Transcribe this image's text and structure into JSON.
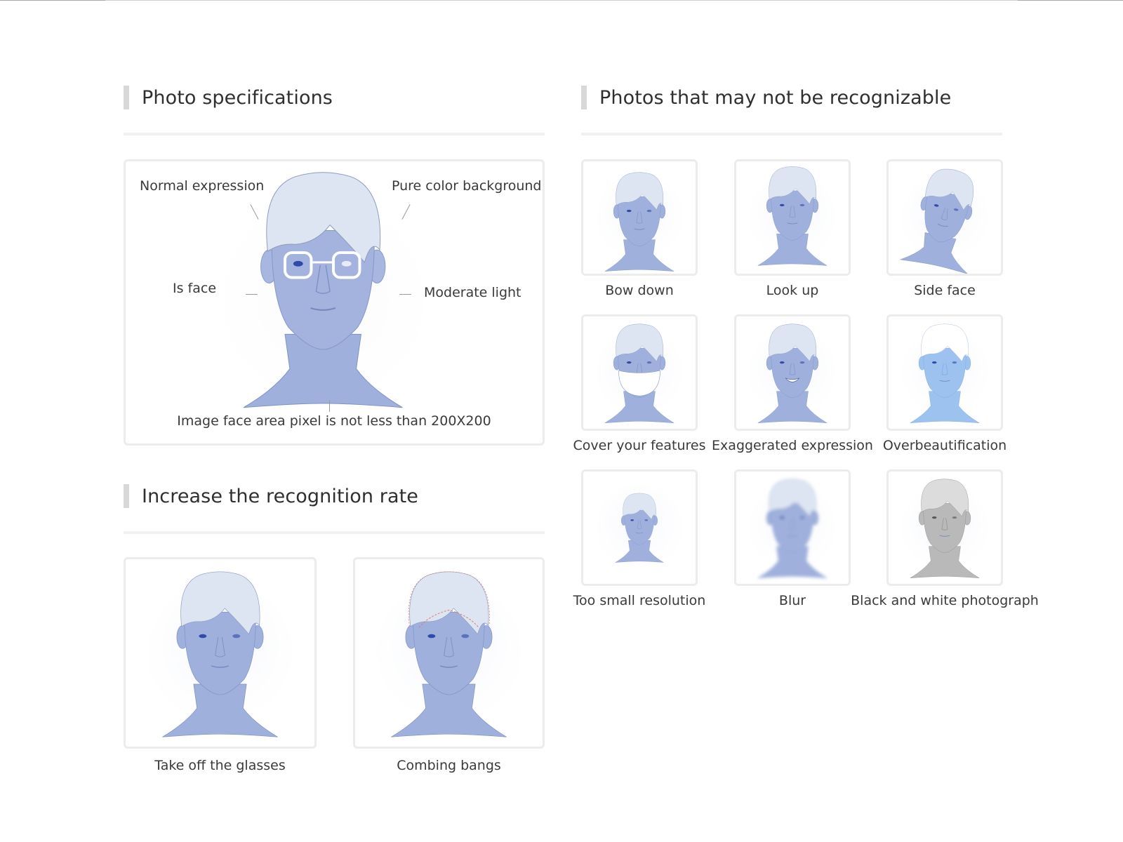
{
  "sections": {
    "specs": {
      "title": "Photo specifications"
    },
    "not_recognizable": {
      "title": "Photos that may not be recognizable"
    },
    "increase": {
      "title": "Increase the recognition rate"
    }
  },
  "spec_card": {
    "labels": {
      "normal_expression": "Normal expression",
      "pure_color_background": "Pure color background",
      "is_face": "Is face",
      "moderate_light": "Moderate light",
      "face_area": "Image face area pixel is not less than 200X200"
    }
  },
  "increase_items": [
    {
      "caption": "Take off the glasses"
    },
    {
      "caption": "Combing bangs"
    }
  ],
  "bad_items": [
    {
      "caption": "Bow down"
    },
    {
      "caption": "Look up"
    },
    {
      "caption": "Side face"
    },
    {
      "caption": "Cover your features"
    },
    {
      "caption": "Exaggerated expression"
    },
    {
      "caption": "Overbeautification"
    },
    {
      "caption": "Too small resolution"
    },
    {
      "caption": "Blur"
    },
    {
      "caption": "Black and white photograph"
    }
  ],
  "colors": {
    "face": "#9fb0dc",
    "face_shadow": "#7f92c6",
    "hair": "#dde5f3",
    "hair_line": "#8e9bbf",
    "card_border": "#ececec",
    "glasses": "#ffffff",
    "eye": "#2f4aa8"
  }
}
